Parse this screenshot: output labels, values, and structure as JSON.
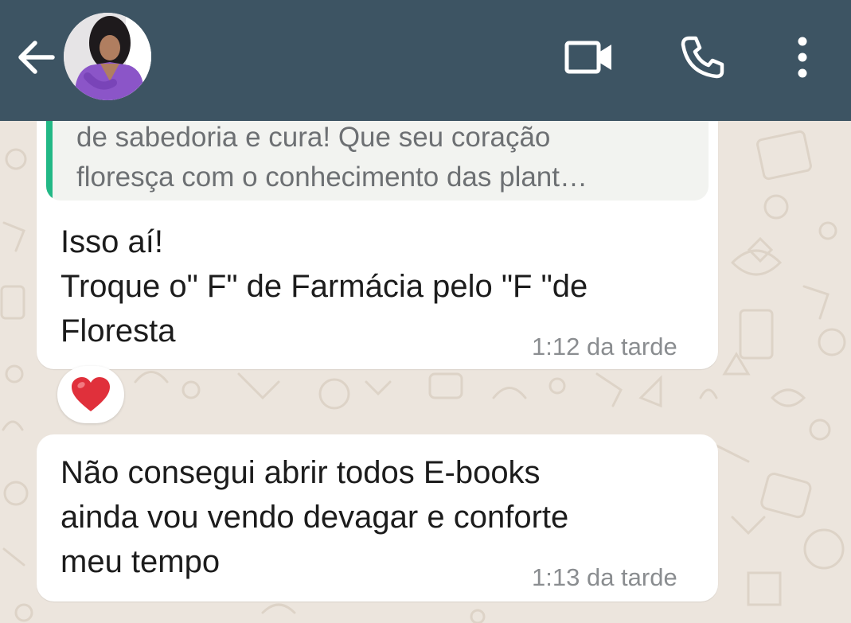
{
  "header": {
    "back_icon": "arrow-left-icon",
    "avatar": "contact-avatar",
    "actions": [
      "video-call-icon",
      "phone-icon",
      "more-vert-icon"
    ],
    "background_color": "#3d5463"
  },
  "messages": [
    {
      "quoted_text": "de sabedoria e cura! Que seu coração\nfloresça com o conhecimento das plant…",
      "text": "Isso aí!\nTroque o\" F\" de Farmácia pelo \"F \"de\nFloresta",
      "time": "1:12 da tarde",
      "reaction": "heart-emoji"
    },
    {
      "text": "Não consegui abrir todos E-books\nainda vou vendo devagar e conforte\nmeu tempo",
      "time": "1:13 da tarde"
    }
  ],
  "colors": {
    "chat_background": "#ece5dd",
    "bubble": "#ffffff",
    "quote_accent": "#22b886",
    "heart": "#e0303b"
  }
}
